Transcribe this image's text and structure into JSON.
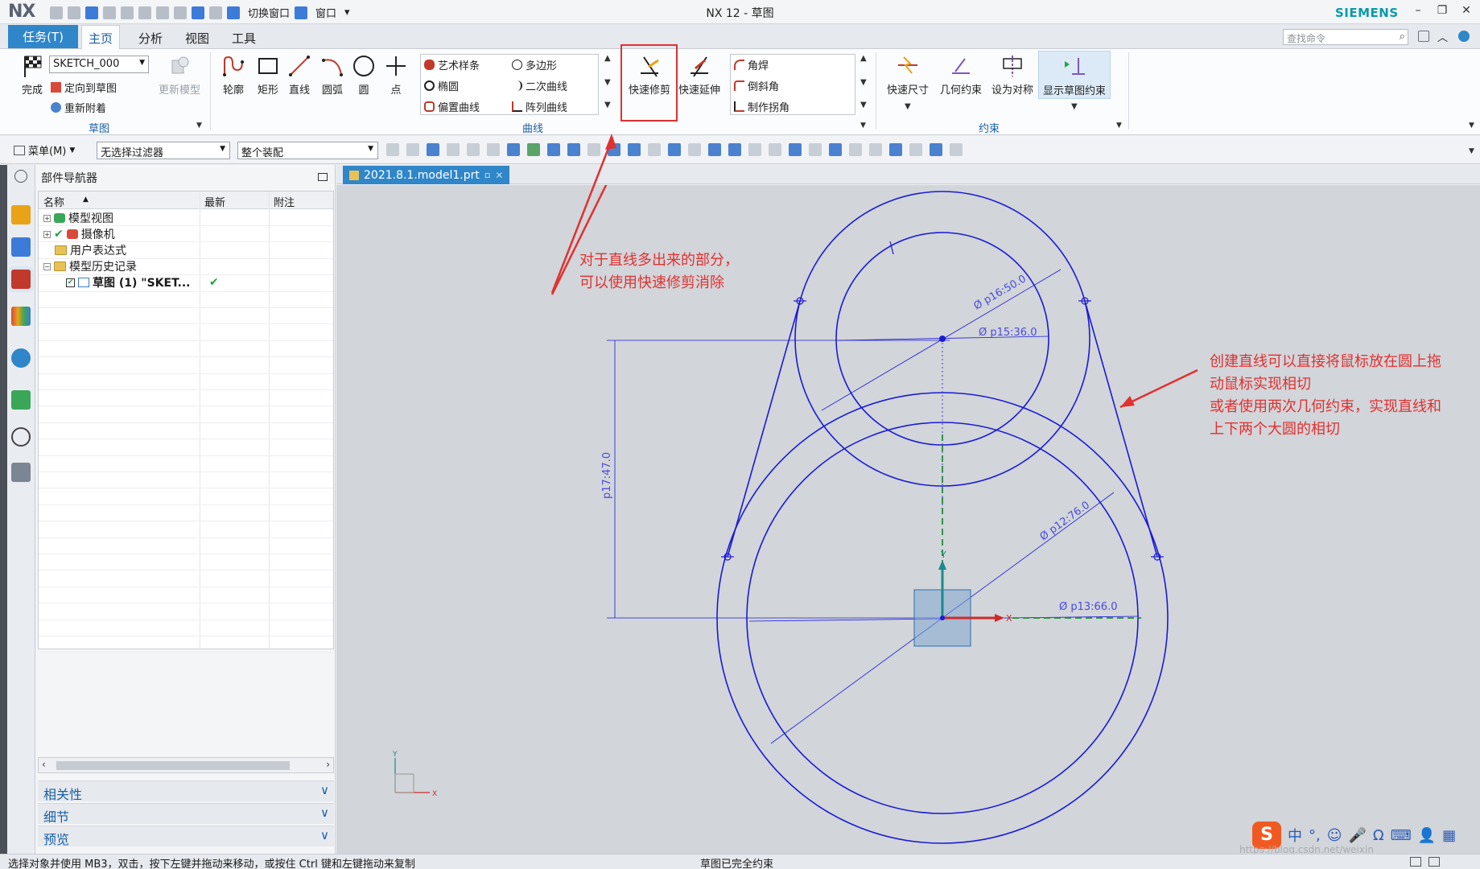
{
  "titlebar": {
    "logo": "NX",
    "title": "NX 12 - 草图",
    "switch_window": "切换窗口",
    "window_menu": "窗口",
    "brand": "SIEMENS"
  },
  "ribbon_tabs": {
    "task": "任务(T)",
    "home": "主页",
    "analysis": "分析",
    "view": "视图",
    "tools": "工具",
    "search_placeholder": "查找命令"
  },
  "sketch_group": {
    "finish": "完成",
    "sketch_name": "SKETCH_000",
    "orient": "定向到草图",
    "reattach": "重新附着",
    "update_model": "更新模型",
    "label": "草图"
  },
  "curve_group": {
    "profile": "轮廓",
    "rectangle": "矩形",
    "line": "直线",
    "arc": "圆弧",
    "circle": "圆",
    "point": "点",
    "studio_spline": "艺术样条",
    "polygon": "多边形",
    "ellipse": "椭圆",
    "conic": "二次曲线",
    "offset_curve": "偏置曲线",
    "pattern_curve": "阵列曲线",
    "quick_trim": "快速修剪",
    "quick_extend": "快速延伸",
    "fillet": "角焊",
    "chamfer": "倒斜角",
    "make_corner": "制作拐角",
    "label": "曲线"
  },
  "constraint_group": {
    "rapid_dim": "快速尺寸",
    "geom_constraint": "几何约束",
    "make_symmetric": "设为对称",
    "show_constraints": "显示草图约束",
    "label": "约束"
  },
  "selbar": {
    "menu": "菜单(M)",
    "type_filter": "无选择过滤器",
    "scope": "整个装配"
  },
  "navigator": {
    "title": "部件导航器",
    "col_name": "名称",
    "col_latest": "最新",
    "col_comment": "附注",
    "rows": [
      {
        "label": "模型视图"
      },
      {
        "label": "摄像机"
      },
      {
        "label": "用户表达式"
      },
      {
        "label": "模型历史记录"
      },
      {
        "label": "草图 (1) \"SKET..."
      }
    ],
    "panels": [
      "相关性",
      "细节",
      "预览"
    ]
  },
  "document_tab": "2021.8.1.model1.prt",
  "dimensions": {
    "d1": "Ø p16:50.0",
    "d2": "Ø p15:36.0",
    "d3": "p17:47.0",
    "d4": "Ø p12:76.0",
    "d5": "Ø p13:66.0"
  },
  "axis": {
    "x": "X",
    "y": "Y"
  },
  "annotations": {
    "trim_line1": "对于直线多出来的部分，",
    "trim_line2": "可以使用快速修剪消除",
    "tangent_line1": "创建直线可以直接将鼠标放在圆上拖",
    "tangent_line2": "动鼠标实现相切",
    "tangent_line3": "或者使用两次几何约束，实现直线和",
    "tangent_line4": "上下两个大圆的相切"
  },
  "status": {
    "hint": "选择对象并使用 MB3，双击，按下左键并拖动来移动，或按住 Ctrl 键和左键拖动来复制",
    "sketch_status": "草图已完全约束"
  },
  "ime": {
    "lang": "中"
  },
  "watermark": "https://blog.csdn.net/weixin_",
  "colors": {
    "accent": "#2f86c9",
    "sketch_curve": "#1a1ad6",
    "annotation": "#e03131",
    "graphics_bg": "#d2d5d9"
  }
}
